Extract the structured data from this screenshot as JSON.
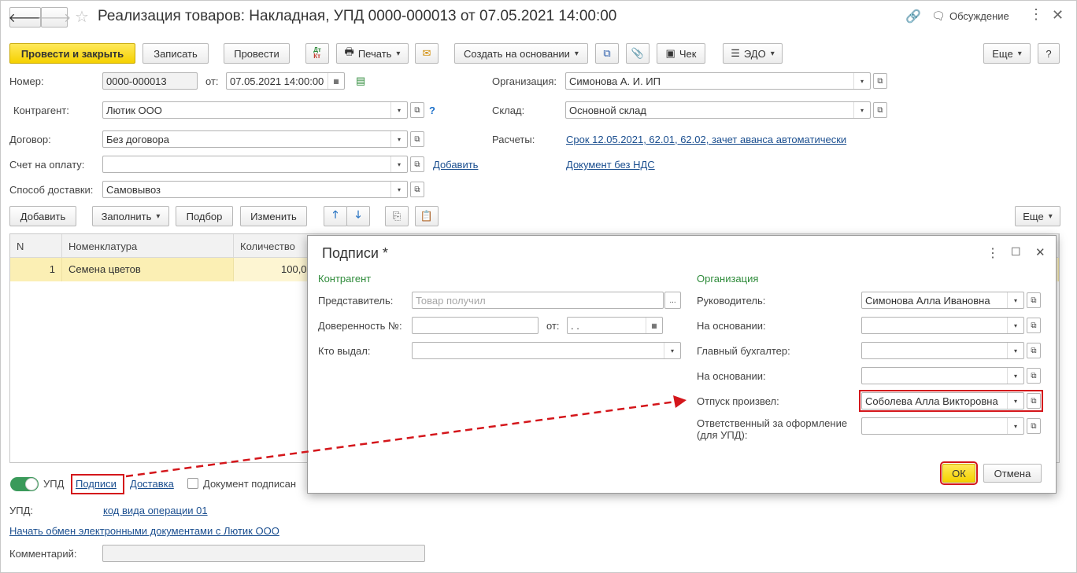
{
  "window": {
    "title": "Реализация товаров: Накладная, УПД 0000-000013 от 07.05.2021 14:00:00",
    "discussion_label": "Обсуждение"
  },
  "toolbar": {
    "post_close": "Провести и закрыть",
    "save": "Записать",
    "post": "Провести",
    "dtkt": "Дт Кт",
    "print": "Печать",
    "create_based": "Создать на основании",
    "check": "Чек",
    "edo": "ЭДО",
    "more": "Еще",
    "help": "?"
  },
  "header": {
    "number_label": "Номер:",
    "number_value": "0000-000013",
    "from_label": "от:",
    "date_value": "07.05.2021 14:00:00",
    "counterparty_label": "Контрагент:",
    "counterparty_value": "Лютик ООО",
    "counterparty_help": "?",
    "contract_label": "Договор:",
    "contract_value": "Без договора",
    "invoice_label": "Счет на оплату:",
    "invoice_value": "",
    "invoice_add_link": "Добавить",
    "delivery_label": "Способ доставки:",
    "delivery_value": "Самовывоз",
    "org_label": "Организация:",
    "org_value": "Симонова А. И. ИП",
    "warehouse_label": "Склад:",
    "warehouse_value": "Основной склад",
    "settlements_label": "Расчеты:",
    "settlements_link": "Срок 12.05.2021, 62.01, 62.02, зачет аванса автоматически",
    "vat_link": "Документ без НДС"
  },
  "table_toolbar": {
    "add": "Добавить",
    "fill": "Заполнить",
    "select": "Подбор",
    "change": "Изменить",
    "more": "Еще"
  },
  "table": {
    "columns": [
      "N",
      "Номенклатура",
      "Количество"
    ],
    "rows": [
      {
        "n": "1",
        "item": "Семена цветов",
        "qty": "100,0"
      }
    ]
  },
  "footer": {
    "upd_toggle_label": "УПД",
    "signatures_link": "Подписи",
    "delivery_link": "Доставка",
    "signed_checkbox_label": "Документ подписан",
    "upd_label": "УПД:",
    "upd_link": "код вида операции 01",
    "edo_link": "Начать обмен электронными документами с Лютик ООО",
    "comment_label": "Комментарий:",
    "comment_value": ""
  },
  "dialog": {
    "title": "Подписи *",
    "left_section": "Контрагент",
    "representative_label": "Представитель:",
    "representative_placeholder": "Товар получил",
    "ellipsis": "...",
    "poa_label": "Доверенность №:",
    "poa_value": "",
    "poa_from_label": "от:",
    "poa_date": " .  .",
    "issued_by_label": "Кто выдал:",
    "issued_by_value": "",
    "right_section": "Организация",
    "head_label": "Руководитель:",
    "head_value": "Симонова Алла Ивановна",
    "basis1_label": "На основании:",
    "chief_accountant_label": "Главный бухгалтер:",
    "basis2_label": "На основании:",
    "released_label": "Отпуск произвел:",
    "released_value": "Соболева Алла Викторовна",
    "responsible_label_line1": "Ответственный за оформление",
    "responsible_label_line2": "(для УПД):",
    "ok": "ОК",
    "cancel": "Отмена"
  },
  "colors": {
    "accent_yellow": "#f5d100",
    "link_blue": "#1a4e8f",
    "section_green": "#2e8b3a",
    "highlight_red": "#d4161b",
    "row_selected": "#fbefb4",
    "toggle_green": "#3a9a5a"
  }
}
